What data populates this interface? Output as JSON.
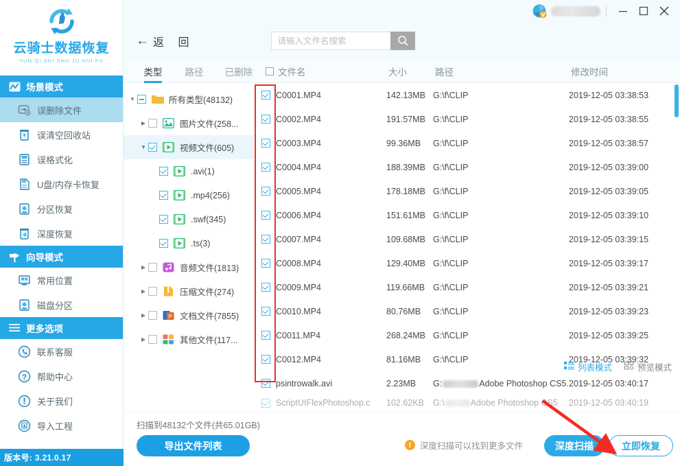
{
  "brand": {
    "title": "云骑士数据恢复",
    "subtitle": "YUN QI SHI SHU JU HUI FU",
    "logo_icon": "recovery-cycle-logo",
    "version": "版本号: 3.21.0.17",
    "accent": "#26a7e6"
  },
  "sidebar": {
    "groups": [
      {
        "label": "场景模式",
        "icon": "scene-mode-icon",
        "items": [
          {
            "label": "误删除文件",
            "icon": "deleted-file-icon",
            "active": true
          },
          {
            "label": "误清空回收站",
            "icon": "recycle-bin-icon",
            "active": false
          },
          {
            "label": "误格式化",
            "icon": "format-disk-icon",
            "active": false
          },
          {
            "label": "U盘/内存卡恢复",
            "icon": "usb-card-icon",
            "active": false
          },
          {
            "label": "分区恢复",
            "icon": "partition-icon",
            "active": false
          },
          {
            "label": "深度恢复",
            "icon": "deep-recovery-icon",
            "active": false
          }
        ]
      },
      {
        "label": "向导模式",
        "icon": "wizard-mode-icon",
        "items": [
          {
            "label": "常用位置",
            "icon": "common-location-icon",
            "active": false
          },
          {
            "label": "磁盘分区",
            "icon": "disk-partition-icon",
            "active": false
          }
        ]
      },
      {
        "label": "更多选项",
        "icon": "hamburger-icon",
        "items": [
          {
            "label": "联系客服",
            "icon": "phone-support-icon",
            "active": false
          },
          {
            "label": "帮助中心",
            "icon": "help-circle-icon",
            "active": false
          },
          {
            "label": "关于我们",
            "icon": "about-info-icon",
            "active": false
          },
          {
            "label": "导入工程",
            "icon": "import-project-icon",
            "active": false
          }
        ]
      }
    ]
  },
  "titlebar": {
    "avatar_icon": "user-vip-avatar",
    "username_redacted": "",
    "minimize_icon": "minimize-icon",
    "maximize_icon": "maximize-icon",
    "close_icon": "close-icon"
  },
  "toolbar": {
    "back_label": "返 回",
    "back_icon": "arrow-left-icon",
    "search_placeholder": "请输入文件名搜索",
    "search_value": "",
    "search_icon": "search-icon"
  },
  "tabs": [
    {
      "label": "类型",
      "active": true
    },
    {
      "label": "路径",
      "active": false
    },
    {
      "label": "已删除",
      "active": false
    }
  ],
  "columns": {
    "name": "文件名",
    "size": "大小",
    "path": "路径",
    "time": "修改时间"
  },
  "tree": [
    {
      "label": "所有类型(48132)",
      "icon": "folder-icon",
      "state": "minus",
      "twisty": "down",
      "indent": 0,
      "selected": false
    },
    {
      "label": "图片文件(258...",
      "icon": "image-file-icon",
      "state": "unchecked",
      "twisty": "right",
      "indent": 1,
      "selected": false
    },
    {
      "label": "视频文件(605)",
      "icon": "video-file-icon",
      "state": "checked",
      "twisty": "down",
      "indent": 1,
      "selected": true
    },
    {
      "label": ".avi(1)",
      "icon": "video-file-icon",
      "state": "checked",
      "twisty": "none",
      "indent": 2,
      "selected": false
    },
    {
      "label": ".mp4(256)",
      "icon": "video-file-icon",
      "state": "checked",
      "twisty": "none",
      "indent": 2,
      "selected": false
    },
    {
      "label": ".swf(345)",
      "icon": "video-file-icon",
      "state": "checked",
      "twisty": "none",
      "indent": 2,
      "selected": false
    },
    {
      "label": ".ts(3)",
      "icon": "video-file-icon",
      "state": "checked",
      "twisty": "none",
      "indent": 2,
      "selected": false
    },
    {
      "label": "音频文件(1813)",
      "icon": "audio-file-icon",
      "state": "unchecked",
      "twisty": "right",
      "indent": 1,
      "selected": false
    },
    {
      "label": "压缩文件(274)",
      "icon": "archive-file-icon",
      "state": "unchecked",
      "twisty": "right",
      "indent": 1,
      "selected": false
    },
    {
      "label": "文档文件(7855)",
      "icon": "document-file-icon",
      "state": "unchecked",
      "twisty": "right",
      "indent": 1,
      "selected": false
    },
    {
      "label": "其他文件(117...",
      "icon": "other-file-icon",
      "state": "unchecked",
      "twisty": "right",
      "indent": 1,
      "selected": false
    }
  ],
  "files": [
    {
      "name": "C0001.MP4",
      "size": "142.13MB",
      "path": "G:\\f\\CLIP",
      "time": "2019-12-05 03:38:53",
      "checked": true,
      "path_blurred": false
    },
    {
      "name": "C0002.MP4",
      "size": "191.57MB",
      "path": "G:\\f\\CLIP",
      "time": "2019-12-05 03:38:55",
      "checked": true,
      "path_blurred": false
    },
    {
      "name": "C0003.MP4",
      "size": "99.36MB",
      "path": "G:\\f\\CLIP",
      "time": "2019-12-05 03:38:57",
      "checked": true,
      "path_blurred": false
    },
    {
      "name": "C0004.MP4",
      "size": "188.39MB",
      "path": "G:\\f\\CLIP",
      "time": "2019-12-05 03:39:00",
      "checked": true,
      "path_blurred": false
    },
    {
      "name": "C0005.MP4",
      "size": "178.18MB",
      "path": "G:\\f\\CLIP",
      "time": "2019-12-05 03:39:05",
      "checked": true,
      "path_blurred": false
    },
    {
      "name": "C0006.MP4",
      "size": "151.61MB",
      "path": "G:\\f\\CLIP",
      "time": "2019-12-05 03:39:10",
      "checked": true,
      "path_blurred": false
    },
    {
      "name": "C0007.MP4",
      "size": "109.68MB",
      "path": "G:\\f\\CLIP",
      "time": "2019-12-05 03:39:15",
      "checked": true,
      "path_blurred": false
    },
    {
      "name": "C0008.MP4",
      "size": "129.40MB",
      "path": "G:\\f\\CLIP",
      "time": "2019-12-05 03:39:17",
      "checked": true,
      "path_blurred": false
    },
    {
      "name": "C0009.MP4",
      "size": "119.66MB",
      "path": "G:\\f\\CLIP",
      "time": "2019-12-05 03:39:21",
      "checked": true,
      "path_blurred": false
    },
    {
      "name": "C0010.MP4",
      "size": "80.76MB",
      "path": "G:\\f\\CLIP",
      "time": "2019-12-05 03:39:23",
      "checked": true,
      "path_blurred": false
    },
    {
      "name": "C0011.MP4",
      "size": "268.24MB",
      "path": "G:\\f\\CLIP",
      "time": "2019-12-05 03:39:25",
      "checked": true,
      "path_blurred": false
    },
    {
      "name": "C0012.MP4",
      "size": "81.16MB",
      "path": "G:\\f\\CLIP",
      "time": "2019-12-05 03:39:32",
      "checked": true,
      "path_blurred": false
    },
    {
      "name": "psintrowalk.avi",
      "size": "2.23MB",
      "path_prefix": "G:",
      "path_suffix": "Adobe Photoshop CS5...",
      "time": "2019-12-05 03:40:17",
      "checked": true,
      "path_blurred": true
    },
    {
      "name": "ScriptUIFlexPhotoshop.c",
      "size": "102.62KB",
      "path_prefix": "G:\\",
      "path_suffix": "Adobe Photoshop CS5",
      "time": "2019-12-05 03:40:19",
      "checked": true,
      "path_blurred": true
    }
  ],
  "viewmodes": [
    {
      "label": "列表模式",
      "icon": "list-view-icon",
      "active": true
    },
    {
      "label": "预览模式",
      "icon": "grid-preview-icon",
      "active": false
    }
  ],
  "footer": {
    "scan_status": "扫描到48132个文件(共65.01GB)",
    "export_label": "导出文件列表",
    "hint_icon": "warning-icon",
    "hint_text": "深度扫描可以找到更多文件",
    "deep_scan_label": "深度扫描",
    "recover_label": "立即恢复"
  },
  "annotations": {
    "checkbox_highlight_color": "#e8312a",
    "arrow_color": "#f32b22",
    "arrow_icon": "red-arrow-pointer"
  }
}
